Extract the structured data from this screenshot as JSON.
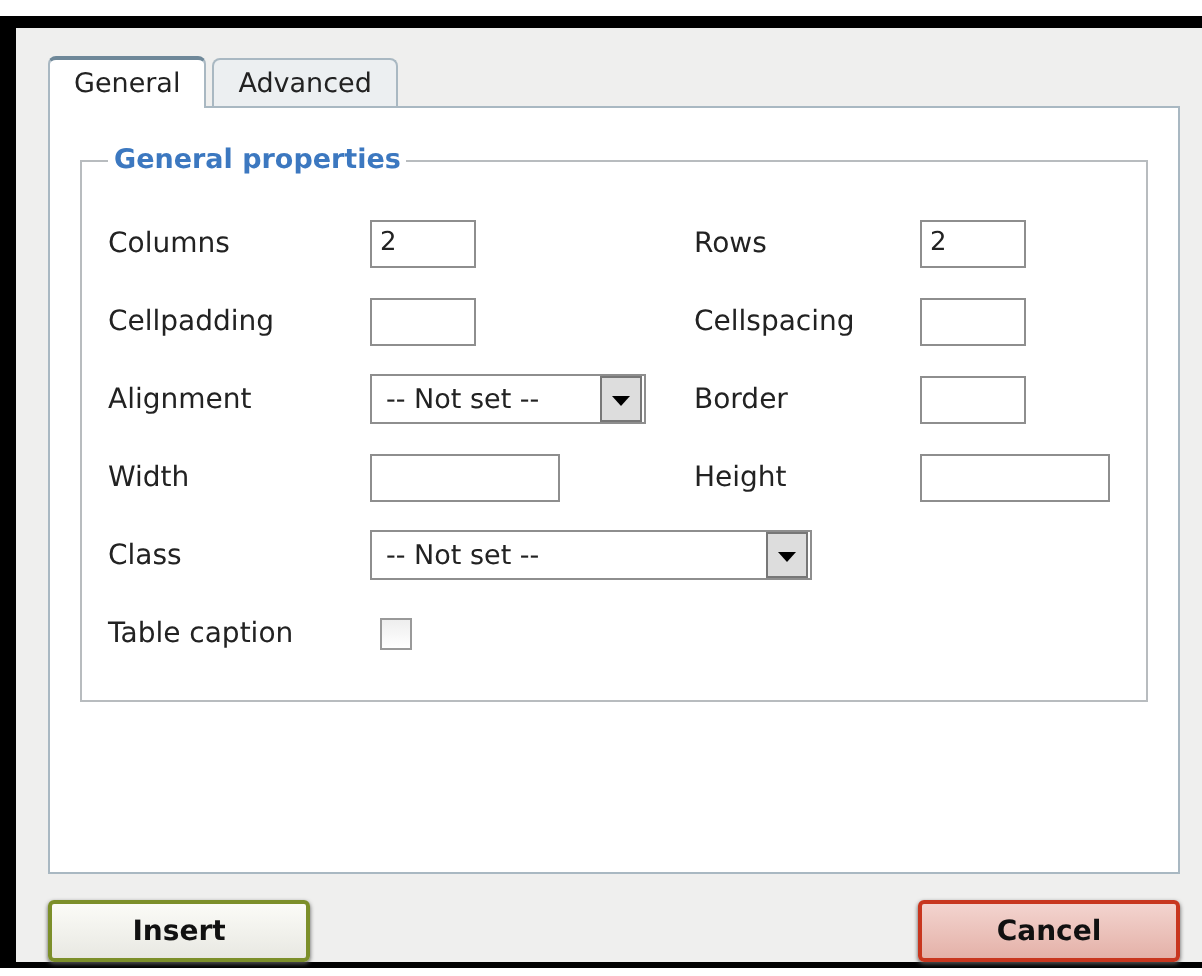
{
  "tabs": [
    {
      "label": "General",
      "selected": true
    },
    {
      "label": "Advanced",
      "selected": false
    }
  ],
  "fieldset": {
    "legend": "General properties",
    "rows": [
      [
        {
          "label": "Columns",
          "kind": "short",
          "value": "2"
        },
        {
          "label": "Rows",
          "kind": "short",
          "value": "2"
        }
      ],
      [
        {
          "label": "Cellpadding",
          "kind": "short"
        },
        {
          "label": "Cellspacing",
          "kind": "short"
        }
      ],
      [
        {
          "label": "Alignment",
          "kind": "select",
          "value": "-- Not set --"
        },
        {
          "label": "Border",
          "kind": "short"
        }
      ],
      [
        {
          "label": "Width",
          "kind": "text"
        },
        {
          "label": "Height",
          "kind": "text"
        }
      ],
      [
        {
          "label": "Class",
          "kind": "wideselect",
          "value": "-- Not set --"
        }
      ],
      [
        {
          "label": "Table caption",
          "kind": "checkbox",
          "checked": false
        }
      ]
    ]
  },
  "buttons": [
    {
      "label": "Insert",
      "kind": "confirm"
    },
    {
      "label": "Cancel",
      "kind": "cancel"
    }
  ]
}
